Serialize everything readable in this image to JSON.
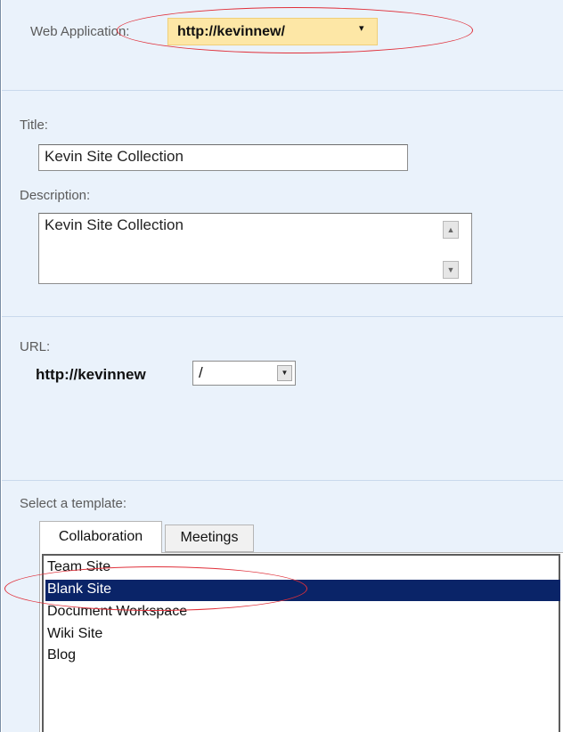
{
  "web_application": {
    "label": "Web Application:",
    "value": "http://kevinnew/",
    "arrow": "▾"
  },
  "title_field": {
    "label": "Title:",
    "value": "Kevin Site Collection"
  },
  "description_field": {
    "label": "Description:",
    "value": "Kevin Site Collection",
    "scroll_up": "▲",
    "scroll_down": "▼"
  },
  "url_field": {
    "label": "URL:",
    "prefix": "http://kevinnew",
    "selected_path": "/",
    "arrow": "▼"
  },
  "template": {
    "label": "Select a template:",
    "tabs": [
      {
        "label": "Collaboration",
        "active": true
      },
      {
        "label": "Meetings",
        "active": false
      }
    ],
    "items": [
      "Team Site",
      "Blank Site",
      "Document Workspace",
      "Wiki Site",
      "Blog"
    ],
    "selected": "Blank Site"
  },
  "colors": {
    "section_bg": "#eaf2fb",
    "highlight_bg": "#fde7a6",
    "selection_bg": "#0a2468",
    "annotation": "#e0303a"
  }
}
